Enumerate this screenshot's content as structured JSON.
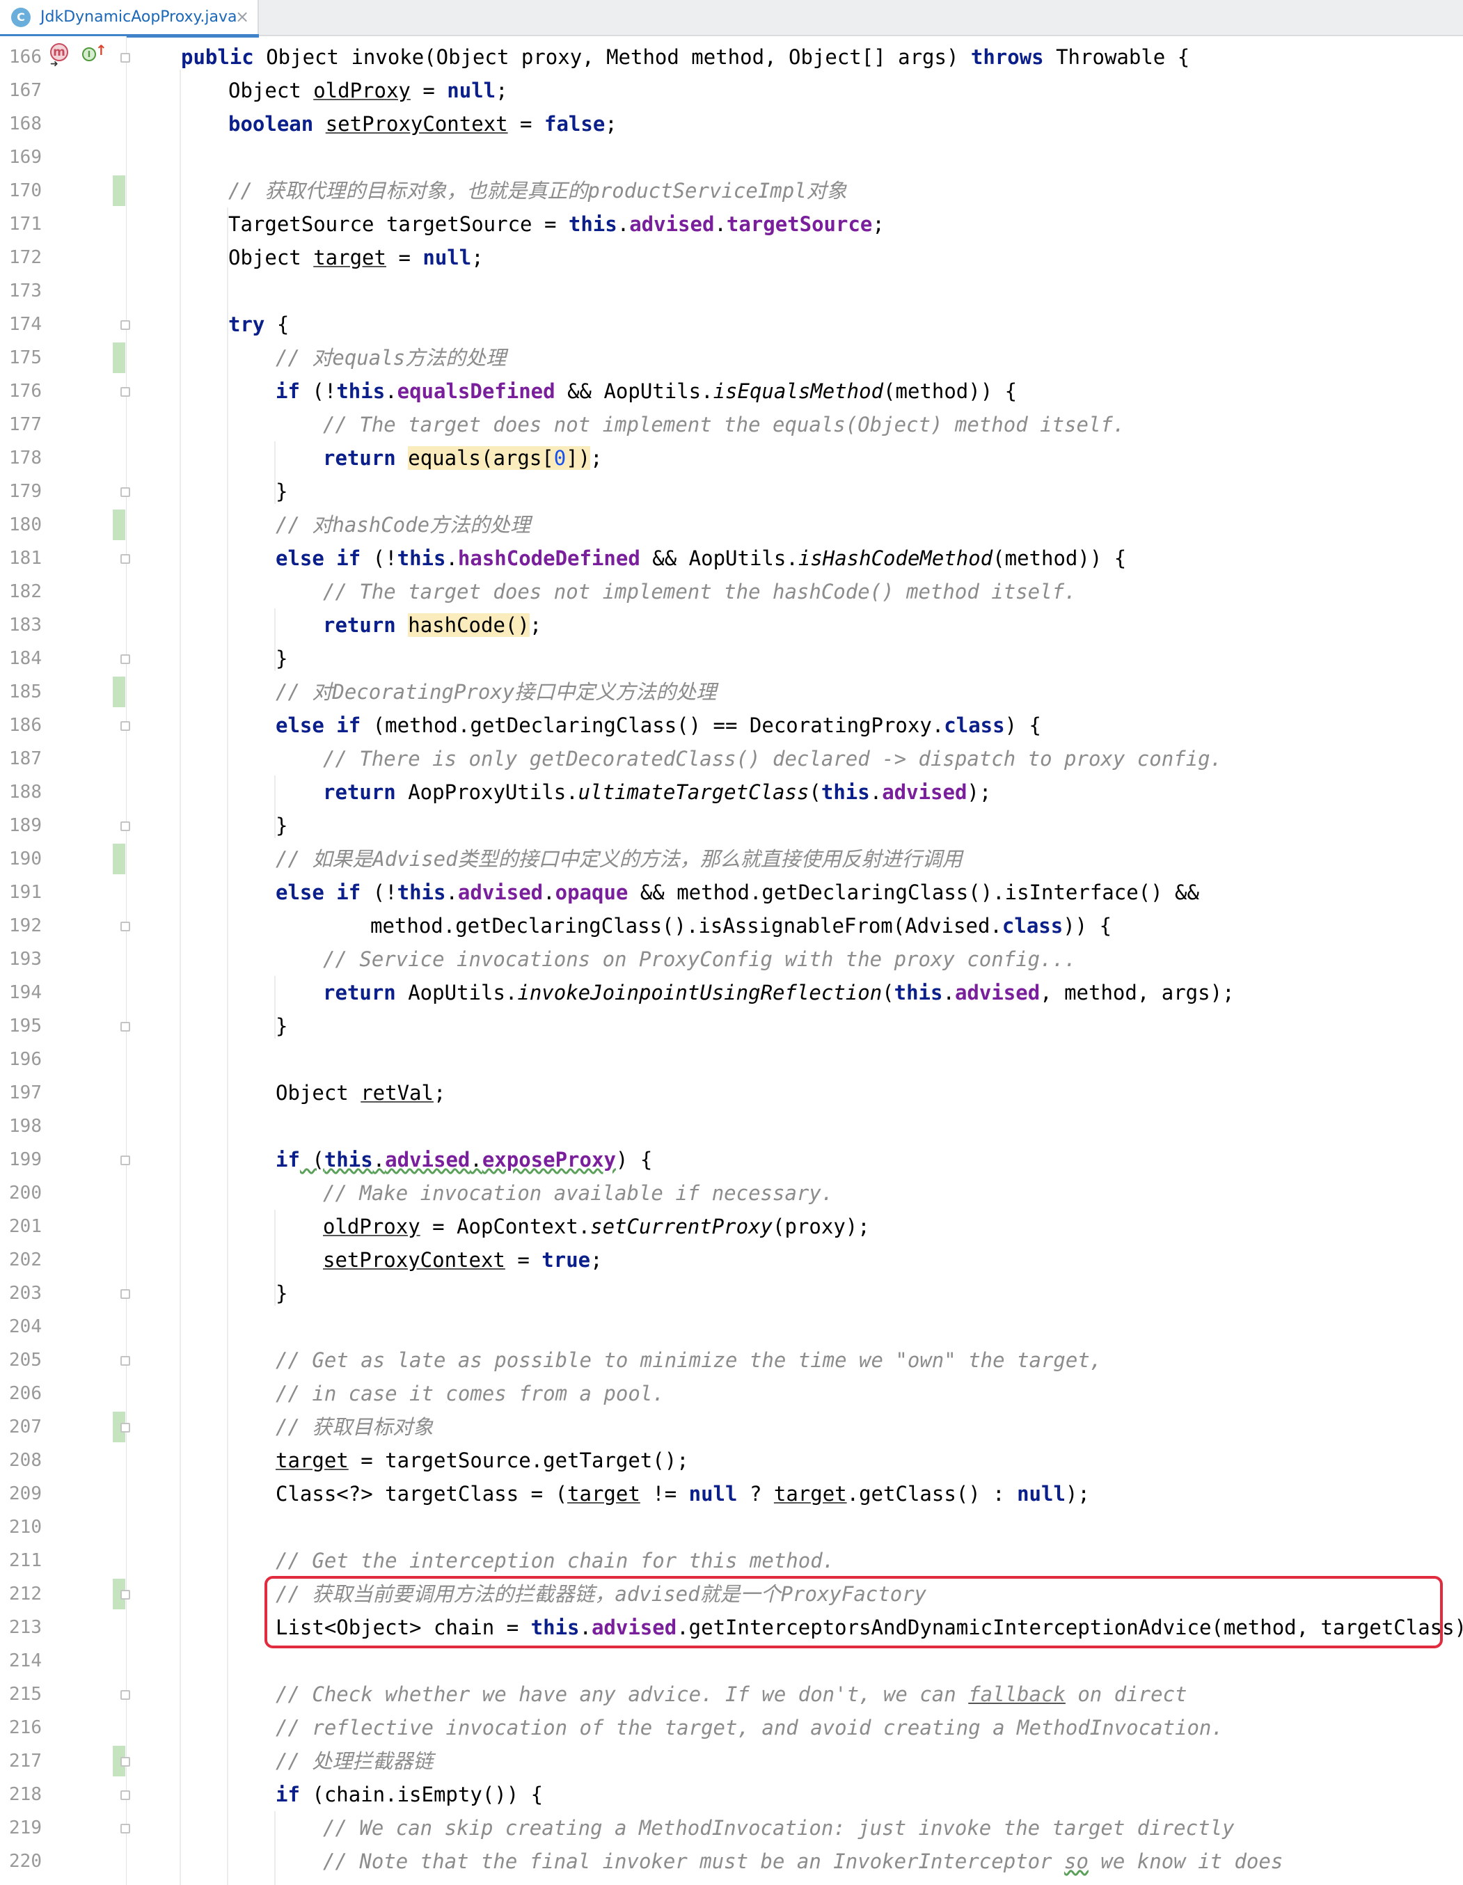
{
  "tab": {
    "title": "JdkDynamicAopProxy.java",
    "icon": "C",
    "icon_color": "#6aaedc",
    "close": "×"
  },
  "gutter": {
    "method_marker": "m",
    "implements_marker": "I"
  },
  "colors": {
    "keyword": "#0b1f8a",
    "field": "#7a1f9b",
    "comment": "#8c8c8c",
    "highlight_box": "#e12b3f"
  },
  "line_numbers": [
    "166",
    "167",
    "168",
    "169",
    "170",
    "171",
    "172",
    "173",
    "174",
    "175",
    "176",
    "177",
    "178",
    "179",
    "180",
    "181",
    "182",
    "183",
    "184",
    "185",
    "186",
    "187",
    "188",
    "189",
    "190",
    "191",
    "192",
    "193",
    "194",
    "195",
    "196",
    "197",
    "198",
    "199",
    "200",
    "201",
    "202",
    "203",
    "204",
    "205",
    "206",
    "207",
    "208",
    "209",
    "210",
    "211",
    "212",
    "213",
    "214",
    "215",
    "216",
    "217",
    "218",
    "219",
    "220"
  ],
  "code": {
    "l166": {
      "kw1": "public",
      "t1": " Object invoke(Object proxy, Method method, Object[] args) ",
      "kw2": "throws",
      "t2": " Throwable {"
    },
    "l167": {
      "t1": "Object ",
      "v1": "oldProxy",
      "t2": " = ",
      "kw1": "null",
      "t3": ";"
    },
    "l168": {
      "kw1": "boolean",
      "t1": " ",
      "v1": "setProxyContext",
      "t2": " = ",
      "kw2": "false",
      "t3": ";"
    },
    "l170": {
      "c": "// 获取代理的目标对象，也就是真正的productServiceImpl对象"
    },
    "l171": {
      "t1": "TargetSource targetSource = ",
      "kw1": "this",
      "t2": ".",
      "f1": "advised",
      "t3": ".",
      "f2": "targetSource",
      "t4": ";"
    },
    "l172": {
      "t1": "Object ",
      "v1": "target",
      "t2": " = ",
      "kw1": "null",
      "t3": ";"
    },
    "l174": {
      "kw1": "try",
      "t1": " {"
    },
    "l175": {
      "c": "// 对equals方法的处理"
    },
    "l176": {
      "kw1": "if",
      "t1": " (!",
      "kw2": "this",
      "t2": ".",
      "f1": "equalsDefined",
      "t3": " && AopUtils.",
      "i1": "isEqualsMethod",
      "t4": "(method)) {"
    },
    "l177": {
      "c": "// The target does not implement the equals(Object) method itself."
    },
    "l178": {
      "kw1": "return",
      "t1": " ",
      "h1": "equals(args[",
      "n1": "0",
      "h2": "])",
      "t2": ";"
    },
    "l179": {
      "t1": "}"
    },
    "l180": {
      "c": "// 对hashCode方法的处理"
    },
    "l181": {
      "kw1": "else if",
      "t1": " (!",
      "kw2": "this",
      "t2": ".",
      "f1": "hashCodeDefined",
      "t3": " && AopUtils.",
      "i1": "isHashCodeMethod",
      "t4": "(method)) {"
    },
    "l182": {
      "c": "// The target does not implement the hashCode() method itself."
    },
    "l183": {
      "kw1": "return",
      "t1": " ",
      "h1": "hashCode()",
      "t2": ";"
    },
    "l184": {
      "t1": "}"
    },
    "l185": {
      "c": "// 对DecoratingProxy接口中定义方法的处理"
    },
    "l186": {
      "kw1": "else if",
      "t1": " (method.getDeclaringClass() == DecoratingProxy.",
      "kw2": "class",
      "t2": ") {"
    },
    "l187": {
      "c": "// There is only getDecoratedClass() declared -> dispatch to proxy config."
    },
    "l188": {
      "kw1": "return",
      "t1": " AopProxyUtils.",
      "i1": "ultimateTargetClass",
      "t2": "(",
      "kw2": "this",
      "t3": ".",
      "f1": "advised",
      "t4": ");"
    },
    "l189": {
      "t1": "}"
    },
    "l190": {
      "c": "// 如果是Advised类型的接口中定义的方法，那么就直接使用反射进行调用"
    },
    "l191": {
      "kw1": "else if",
      "t1": " (!",
      "kw2": "this",
      "t2": ".",
      "f1": "advised",
      "t3": ".",
      "f2": "opaque",
      "t4": " && method.getDeclaringClass().isInterface() &&"
    },
    "l192": {
      "t1": "method.getDeclaringClass().isAssignableFrom(Advised.",
      "kw1": "class",
      "t2": ")) {"
    },
    "l193": {
      "c": "// Service invocations on ProxyConfig with the proxy config..."
    },
    "l194": {
      "kw1": "return",
      "t1": " AopUtils.",
      "i1": "invokeJoinpointUsingReflection",
      "t2": "(",
      "kw2": "this",
      "t3": ".",
      "f1": "advised",
      "t4": ", method, args);"
    },
    "l195": {
      "t1": "}"
    },
    "l197": {
      "t1": "Object ",
      "v1": "retVal",
      "t2": ";"
    },
    "l199": {
      "kw1": "if",
      "t1": " (",
      "kw2": "this",
      "t2": ".",
      "f1": "advised",
      "t3": ".",
      "f2": "exposeProxy",
      "t4": ") {"
    },
    "l200": {
      "c": "// Make invocation available if necessary."
    },
    "l201": {
      "v1": "oldProxy",
      "t1": " = AopContext.",
      "i1": "setCurrentProxy",
      "t2": "(proxy);"
    },
    "l202": {
      "v1": "setProxyContext",
      "t1": " = ",
      "kw1": "true",
      "t2": ";"
    },
    "l203": {
      "t1": "}"
    },
    "l205": {
      "c": "// Get as late as possible to minimize the time we \"own\" the target,"
    },
    "l206": {
      "c": "// in case it comes from a pool."
    },
    "l207": {
      "c": "// 获取目标对象"
    },
    "l208": {
      "v1": "target",
      "t1": " = targetSource.getTarget();"
    },
    "l209": {
      "t1": "Class<?> targetClass = (",
      "v1": "target",
      "t2": " != ",
      "kw1": "null",
      "t3": " ? ",
      "v2": "target",
      "t4": ".getClass() : ",
      "kw2": "null",
      "t5": ");"
    },
    "l211": {
      "c": "// Get the interception chain for this method."
    },
    "l212": {
      "c": "// 获取当前要调用方法的拦截器链，advised就是一个ProxyFactory"
    },
    "l213": {
      "t1": "List<Object> chain = ",
      "kw1": "this",
      "t2": ".",
      "f1": "advised",
      "t3": ".getInterceptorsAndDynamicInterceptionAdvice(method, targetClass);"
    },
    "l215": {
      "c1": "// Check whether we have any advice. If we don't, we can ",
      "w1": "fallback",
      "c2": " on direct"
    },
    "l216": {
      "c": "// reflective invocation of the target, and avoid creating a MethodInvocation."
    },
    "l217": {
      "c": "// 处理拦截器链"
    },
    "l218": {
      "kw1": "if",
      "t1": " (chain.isEmpty()) {"
    },
    "l219": {
      "c": "// We can skip creating a MethodInvocation: just invoke the target directly"
    },
    "l220": {
      "c1": "// Note that the final invoker must be an InvokerInterceptor ",
      "w1": "so",
      "c2": " we know it does"
    }
  }
}
